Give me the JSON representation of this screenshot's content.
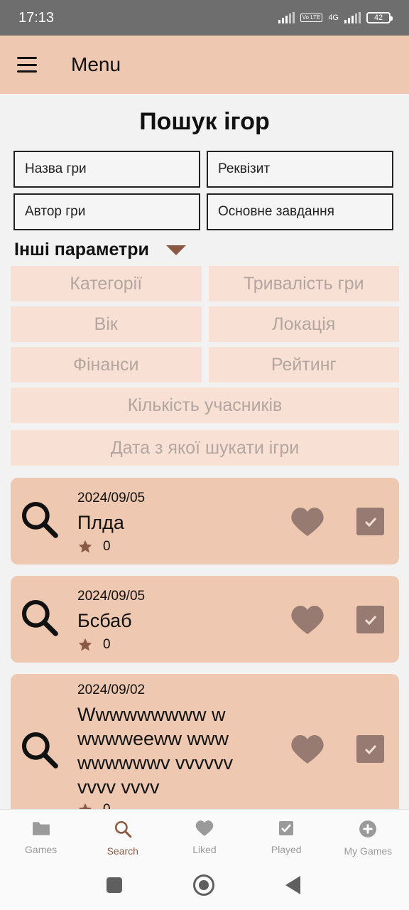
{
  "status_bar": {
    "time": "17:13",
    "network": "4G",
    "volte": "Vo LTE",
    "battery": "42"
  },
  "app_bar": {
    "title": "Menu"
  },
  "page": {
    "title": "Пошук ігор",
    "fields": [
      "Назва гри",
      "Реквізит",
      "Автор гри",
      "Основне завдання"
    ],
    "other_params_label": "Інші параметри",
    "filters": {
      "categories": "Категорії",
      "duration": "Тривалість гри",
      "age": "Вік",
      "location": "Локація",
      "finances": "Фінанси",
      "rating": "Рейтинг",
      "participants": "Кількість учасників",
      "date_from": "Дата з якої шукати ігри"
    }
  },
  "results": [
    {
      "date": "2024/09/05",
      "title": "Плда",
      "rating": "0"
    },
    {
      "date": "2024/09/05",
      "title": "Бсбаб",
      "rating": "0"
    },
    {
      "date": "2024/09/02",
      "title": "Wwwwwwwww wwwwweeww wwwwwwwwwv vvvvvvvvvv vvvv",
      "rating": "0"
    }
  ],
  "bottom_nav": [
    {
      "label": "Games",
      "icon": "folder-icon"
    },
    {
      "label": "Search",
      "icon": "search-icon",
      "active": true
    },
    {
      "label": "Liked",
      "icon": "heart-icon"
    },
    {
      "label": "Played",
      "icon": "checkbox-icon"
    },
    {
      "label": "My Games",
      "icon": "add-circle-icon"
    }
  ],
  "colors": {
    "accent": "#8a5a44",
    "app_bar": "#eec8b0",
    "card": "#eec8b0",
    "filter_bg": "#f9e0d4"
  }
}
